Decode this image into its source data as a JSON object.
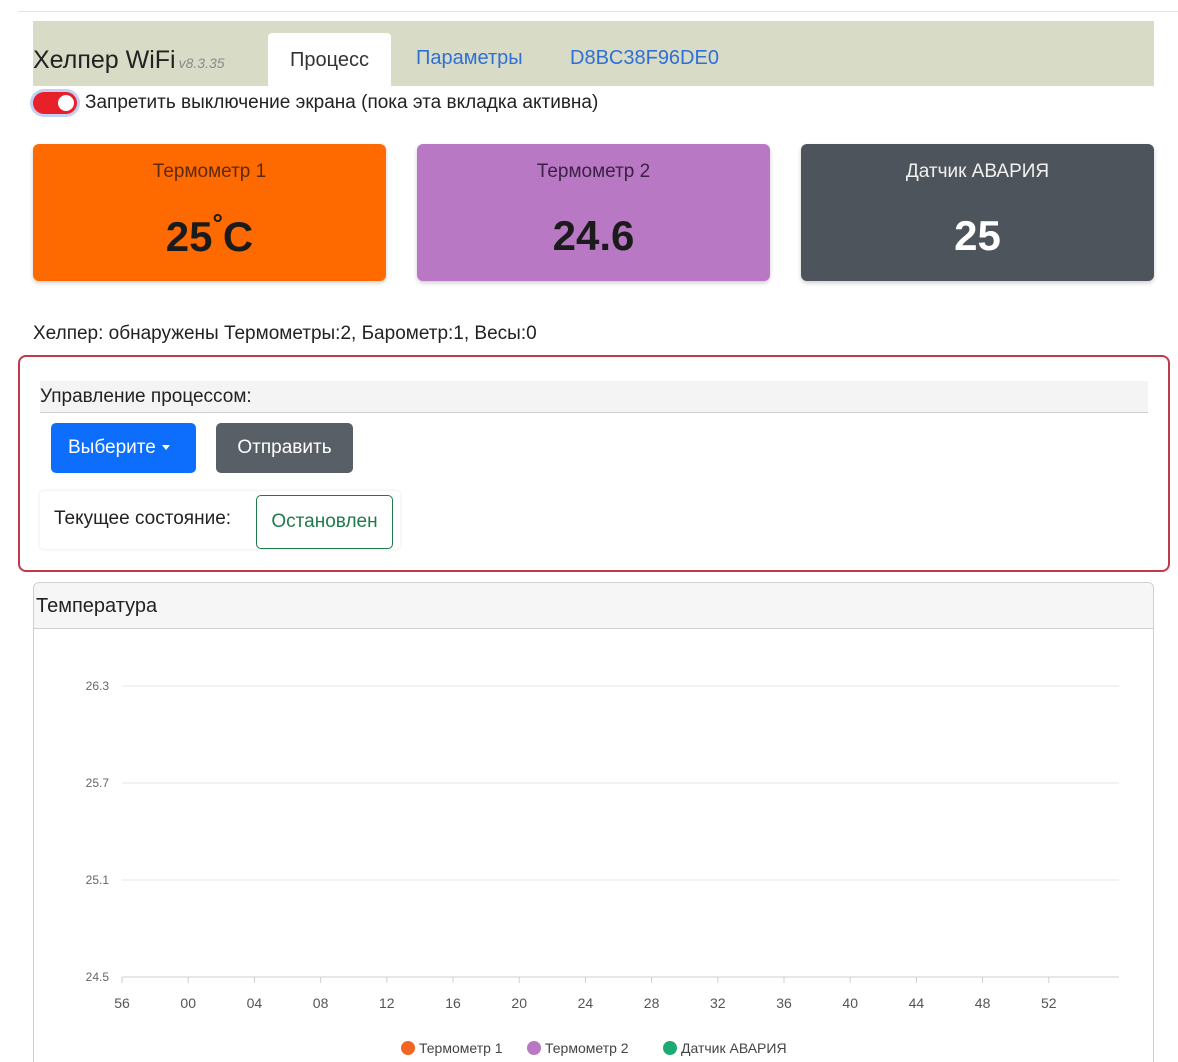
{
  "header": {
    "app_name": "Хелпер WiFi",
    "version": "v8.3.35",
    "tabs": [
      {
        "label": "Процесс",
        "active": true
      },
      {
        "label": "Параметры",
        "active": false
      },
      {
        "label": "D8BC38F96DE0",
        "active": false
      }
    ]
  },
  "wake_lock": {
    "enabled": true,
    "label": "Запретить выключение экрана (пока эта вкладка активна)"
  },
  "cards": [
    {
      "title": "Термометр 1",
      "value": "25",
      "unit": "C",
      "unit_prefix": "°",
      "color": "#ff6a00"
    },
    {
      "title": "Термометр 2",
      "value": "24.6",
      "color": "#b878c4"
    },
    {
      "title": "Датчик АВАРИЯ",
      "value": "25",
      "color": "#4e545b"
    }
  ],
  "detected_text": "Хелпер: обнаружены Термометры:2, Барометр:1, Весы:0",
  "control": {
    "title": "Управление процессом:",
    "select_label": "Выберите",
    "send_label": "Отправить",
    "state_label": "Текущее состояние:",
    "state_value": "Остановлен"
  },
  "chart_panel": {
    "title": "Температура"
  },
  "chart_data": {
    "type": "line",
    "title": "",
    "xlabel": "",
    "ylabel": "",
    "x": [
      "56",
      "00",
      "04",
      "08",
      "12",
      "16",
      "20",
      "24",
      "28",
      "32",
      "36",
      "40",
      "44",
      "48",
      "52"
    ],
    "y_ticks": [
      "26.3",
      "25.7",
      "25.1",
      "24.5"
    ],
    "ylim": [
      24.5,
      26.3
    ],
    "grid": true,
    "legend_position": "bottom",
    "series": [
      {
        "name": "Термометр 1",
        "color": "#f26522",
        "values": []
      },
      {
        "name": "Термометр 2",
        "color": "#b878c4",
        "values": []
      },
      {
        "name": "Датчик АВАРИЯ",
        "color": "#1aab72",
        "values": []
      }
    ]
  }
}
